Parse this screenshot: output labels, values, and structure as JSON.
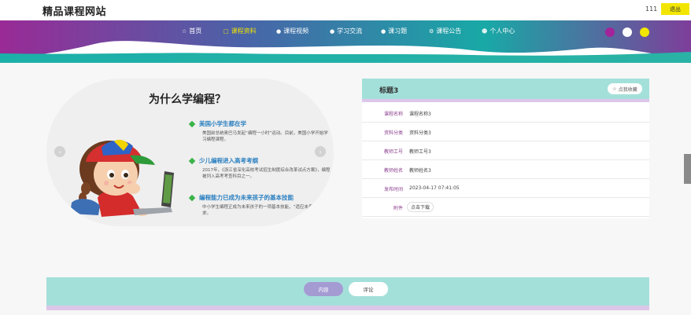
{
  "header": {
    "site_title": "精品课程网站",
    "user_name": "111",
    "logout_label": "退出"
  },
  "nav": {
    "items": [
      {
        "label": "首页",
        "icon": "home-icon"
      },
      {
        "label": "课程资料",
        "icon": "bag-icon",
        "active": true
      },
      {
        "label": "课程视频",
        "icon": "circle-icon"
      },
      {
        "label": "学习交流",
        "icon": "circle-icon"
      },
      {
        "label": "课习题",
        "icon": "circle-icon"
      },
      {
        "label": "课程公告",
        "icon": "settings-icon"
      },
      {
        "label": "个人中心",
        "icon": "user-icon"
      }
    ],
    "color_dots": [
      "#a3239a",
      "#ffffff",
      "#f2e600"
    ]
  },
  "carousel": {
    "title": "为什么学编程？",
    "points": [
      {
        "title": "美国小学生都在学",
        "desc": "美国前总统奥巴马发起“编程一小时”运动。目前，美国小学开始学习编程课程。"
      },
      {
        "title": "少儿编程进入高考考纲",
        "desc": "2017年，《浙江省深化高校考试招生制度综合改革试点方案》，编程被列入高考考查科目之一。"
      },
      {
        "title": "编程能力已成为未来孩子的基本技能",
        "desc": "中小学生编程正成为未来孩子的一项基本技能，“适应未来社会的要求。"
      }
    ]
  },
  "detail": {
    "title": "标题3",
    "favorite_label": "点我收藏",
    "fields": [
      {
        "label": "课程名称",
        "value": "课程名称3"
      },
      {
        "label": "资料分类",
        "value": "资料分类3"
      },
      {
        "label": "教师工号",
        "value": "教师工号3"
      },
      {
        "label": "教师姓名",
        "value": "教师姓名3"
      },
      {
        "label": "发布时间",
        "value": "2023-04-17 07:41:05"
      }
    ],
    "attachment_label": "附件",
    "download_label": "点击下载"
  },
  "bottom_tabs": {
    "content_label": "内容",
    "comment_label": "评论"
  },
  "colors": {
    "teal": "#a4e0da",
    "purple": "#8a3f8e",
    "lavender": "#dcc6ea",
    "yellow": "#f2e600"
  }
}
